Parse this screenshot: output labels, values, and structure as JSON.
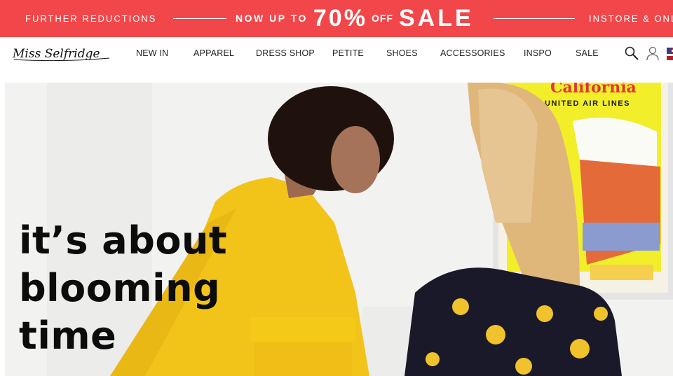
{
  "promo": {
    "left_text": "FURTHER REDUCTIONS",
    "now_up_to": "NOW UP TO",
    "percent": "70%",
    "off": "OFF",
    "sale": "SALE",
    "right_text": "INSTORE & ONLINE",
    "background": "#f2474a"
  },
  "brand": {
    "logo_text": "Miss Selfridge"
  },
  "nav": {
    "items": [
      "NEW IN",
      "APPAREL",
      "DRESS SHOP",
      "PETITE",
      "SHOES",
      "ACCESSORIES",
      "INSPO",
      "SALE"
    ],
    "icons": [
      "search-icon",
      "account-icon",
      "country-flag-icon"
    ]
  },
  "hero": {
    "headline": [
      "it’s about",
      "blooming",
      "time"
    ],
    "poster_text": [
      "California",
      "UNITED AIR LINES"
    ]
  }
}
